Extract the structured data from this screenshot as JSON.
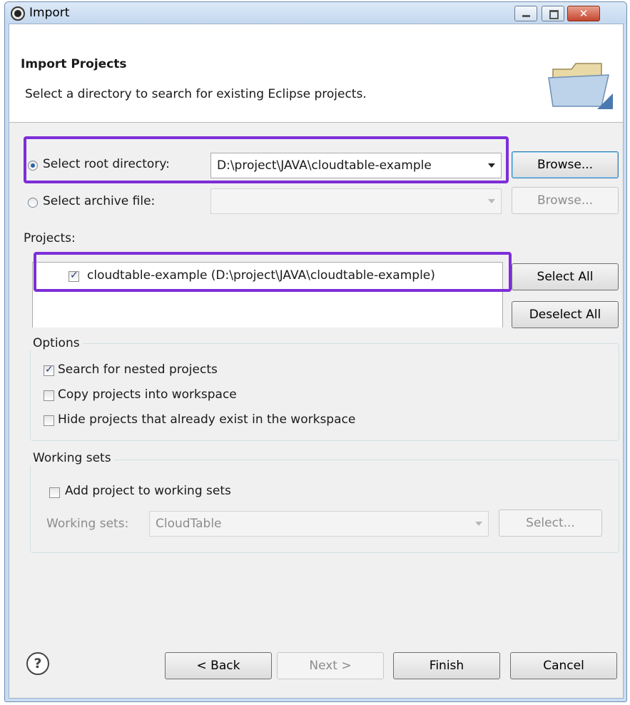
{
  "window": {
    "title": "Import",
    "controls": {
      "minimize": "minimize-icon",
      "maximize": "maximize-icon",
      "close": "close-icon"
    }
  },
  "header": {
    "title": "Import Projects",
    "description": "Select a directory to search for existing Eclipse projects.",
    "icon": "folder-icon"
  },
  "source": {
    "root_directory_label": "Select root directory:",
    "root_directory_value": "D:\\project\\JAVA\\cloudtable-example",
    "root_selected": true,
    "archive_file_label": "Select archive file:",
    "archive_file_value": "",
    "browse_root_label": "Browse...",
    "browse_archive_label": "Browse..."
  },
  "projects": {
    "label": "Projects:",
    "items": [
      {
        "label": "cloudtable-example (D:\\project\\JAVA\\cloudtable-example)",
        "checked": true
      }
    ],
    "select_all_label": "Select All",
    "deselect_all_label": "Deselect All"
  },
  "options": {
    "title": "Options",
    "items": [
      {
        "label": "Search for nested projects",
        "checked": true
      },
      {
        "label": "Copy projects into workspace",
        "checked": false
      },
      {
        "label": "Hide projects that already exist in the workspace",
        "checked": false
      }
    ]
  },
  "working_sets": {
    "title": "Working sets",
    "add_label": "Add project to working sets",
    "add_checked": false,
    "sets_label": "Working sets:",
    "sets_value": "CloudTable",
    "select_label": "Select..."
  },
  "footer": {
    "help_icon": "help-icon",
    "help_glyph": "?",
    "back_label": "< Back",
    "next_label": "Next >",
    "finish_label": "Finish",
    "cancel_label": "Cancel"
  },
  "colors": {
    "highlight": "#7d2ed8",
    "radio_dot": "#2b62a8",
    "window_frame": "#c9dcf1"
  }
}
